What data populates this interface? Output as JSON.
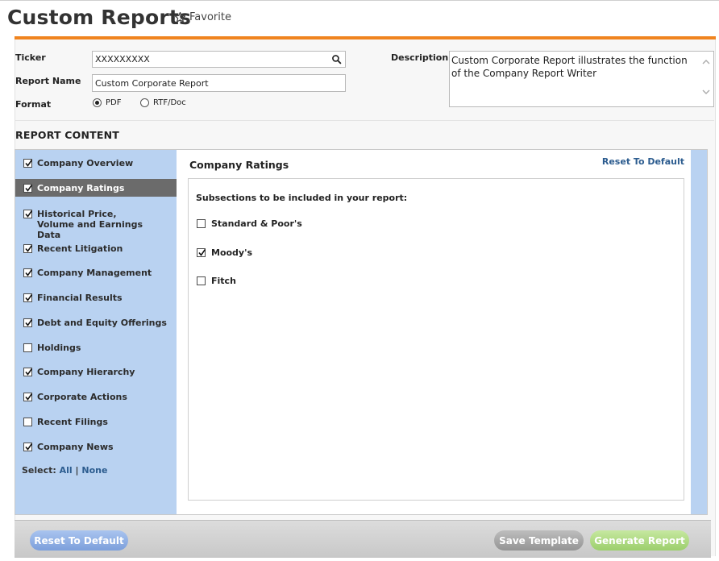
{
  "header": {
    "title": "Custom Reports",
    "favorite_label": "Favorite"
  },
  "form": {
    "ticker_label": "Ticker",
    "ticker_value": "XXXXXXXXX",
    "report_name_label": "Report Name",
    "report_name_value": "Custom Corporate Report",
    "format_label": "Format",
    "format_options": [
      "PDF",
      "RTF/Doc"
    ],
    "format_selected": "PDF",
    "description_label": "Description",
    "description_value": "Custom Corporate Report illustrates the function of the Company Report Writer"
  },
  "report_content": {
    "title": "REPORT CONTENT",
    "sections": [
      {
        "label": "Company Overview",
        "checked": true
      },
      {
        "label": "Company Ratings",
        "checked": true
      },
      {
        "label": "Historical Price, Volume and Earnings Data",
        "checked": true
      },
      {
        "label": "Recent Litigation",
        "checked": true
      },
      {
        "label": "Company Management",
        "checked": true
      },
      {
        "label": "Financial Results",
        "checked": true
      },
      {
        "label": "Debt and Equity Offerings",
        "checked": true
      },
      {
        "label": "Holdings",
        "checked": false
      },
      {
        "label": "Company Hierarchy",
        "checked": true
      },
      {
        "label": "Corporate Actions",
        "checked": true
      },
      {
        "label": "Recent Filings",
        "checked": false
      },
      {
        "label": "Company News",
        "checked": true
      }
    ],
    "active_section": "Company Ratings",
    "select_label": "Select:",
    "select_all": "All",
    "select_separator": "|",
    "select_none": "None"
  },
  "detail": {
    "title": "Company Ratings",
    "reset_label": "Reset To Default",
    "subsections_label": "Subsections to be included in your report:",
    "subsections": [
      {
        "label": "Standard & Poor's",
        "checked": false
      },
      {
        "label": "Moody's",
        "checked": true
      },
      {
        "label": "Fitch",
        "checked": false
      }
    ]
  },
  "footer": {
    "reset_button": "Reset To Default",
    "save_button": "Save Template",
    "generate_button": "Generate Report"
  },
  "colors": {
    "accent": "#f0841f",
    "sidebar_bg": "#b9d2f1",
    "active_item": "#6b6b6b",
    "link": "#2c5c8f"
  }
}
